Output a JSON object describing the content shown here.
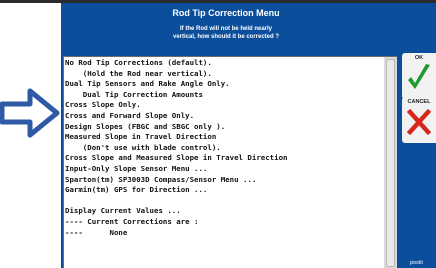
{
  "dialog": {
    "title": "Rod Tip Correction Menu",
    "prompt_lines": [
      "If the Rod will not be held nearly",
      "vertical, how should it be corrected ?"
    ]
  },
  "menu": {
    "items": [
      "No Rod Tip Corrections (default).",
      "    (Hold the Rod near vertical).",
      "Dual Tip Sensors and Rake Angle Only.",
      "    Dual Tip Correction Amounts",
      "Cross Slope Only.",
      "Cross and Forward Slope Only.",
      "Design Slopes (FBGC and SBGC only ).",
      "Measured Slope in Travel Direction",
      "    (Don't use with blade control).",
      "Cross Slope and Measured Slope in Travel Direction",
      "Input-Only Slope Sensor Menu ...",
      "Sparton(tm) SP3003D Compass/Sensor Menu ...",
      "Garmin(tm) GPS for Direction ...",
      "",
      "Display Current Values ...",
      "---- Current Corrections are :",
      "----      None"
    ]
  },
  "buttons": {
    "ok_label": "OK",
    "cancel_label": "CANCEL"
  },
  "footer": {
    "corner_text": "positi"
  },
  "colors": {
    "dialog_background": "#0b4f9c",
    "ok_check": "#1f9a2e",
    "cancel_x": "#d9261c",
    "pointer_arrow": "#2f5aa6"
  },
  "icons": {
    "pointer": "right-arrow-icon",
    "ok": "checkmark-icon",
    "cancel": "x-icon"
  }
}
